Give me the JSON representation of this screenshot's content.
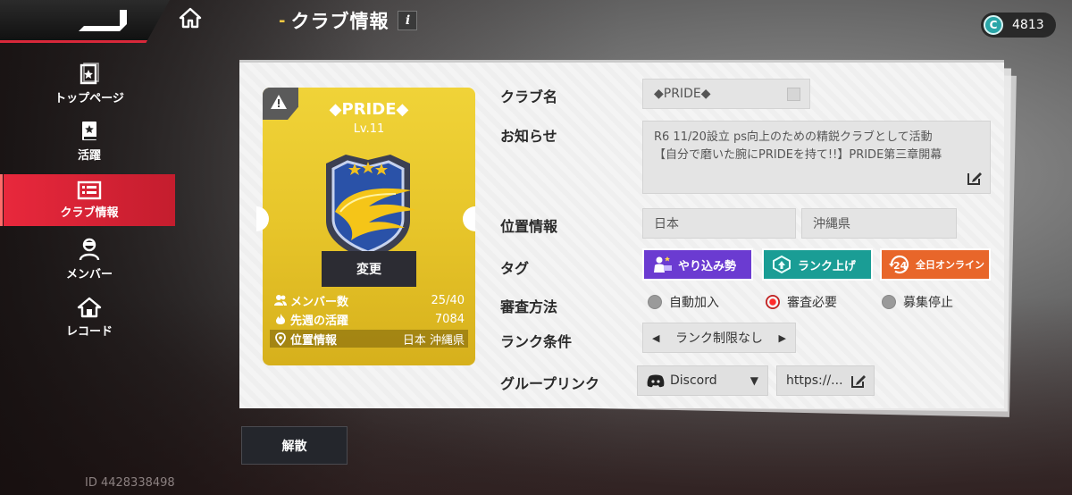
{
  "header": {
    "title": "クラブ情報",
    "info_icon": "i",
    "currency": {
      "icon_letter": "C",
      "amount": "4813"
    }
  },
  "sidebar": {
    "items": [
      {
        "label": "トップページ",
        "icon": "card-star-icon",
        "active": false
      },
      {
        "label": "活躍",
        "icon": "book-star-icon",
        "active": false
      },
      {
        "label": "クラブ情報",
        "icon": "list-icon",
        "active": true
      },
      {
        "label": "メンバー",
        "icon": "member-icon",
        "active": false
      },
      {
        "label": "レコード",
        "icon": "home-record-icon",
        "active": false
      }
    ],
    "user_id": "ID 4428338498"
  },
  "club_card": {
    "name": "◆PRIDE◆",
    "level": "Lv.11",
    "change_button": "変更",
    "stats": {
      "members_label": "メンバー数",
      "members_value": "25/40",
      "activity_label": "先週の活躍",
      "activity_value": "7084",
      "location_label": "位置情報",
      "location_value": "日本 沖縄県"
    }
  },
  "form": {
    "club_name_label": "クラブ名",
    "club_name_value": "◆PRIDE◆",
    "notice_label": "お知らせ",
    "notice_line1": "R6 11/20設立 ps向上のための精鋭クラブとして活動",
    "notice_line2": "【自分で磨いた腕にPRIDEを持て!!】PRIDE第三章開幕",
    "location_label": "位置情報",
    "country": "日本",
    "prefecture": "沖縄県",
    "tag_label": "タグ",
    "tags": [
      "やり込み勢",
      "ランク上げ",
      "全日オンライン"
    ],
    "tag_colors": [
      "#6b3bd1",
      "#1a9d95",
      "#e8662a"
    ],
    "review_label": "審査方法",
    "review_options": [
      "自動加入",
      "審査必要",
      "募集停止"
    ],
    "review_selected": "審査必要",
    "rank_label": "ランク条件",
    "rank_value": "ランク制限なし",
    "group_link_label": "グループリンク",
    "link_platform": "Discord",
    "link_value": "https://..."
  },
  "disband_button": "解散",
  "colors": {
    "accent_red": "#e8283c",
    "panel_gold": "#e7c52a"
  }
}
